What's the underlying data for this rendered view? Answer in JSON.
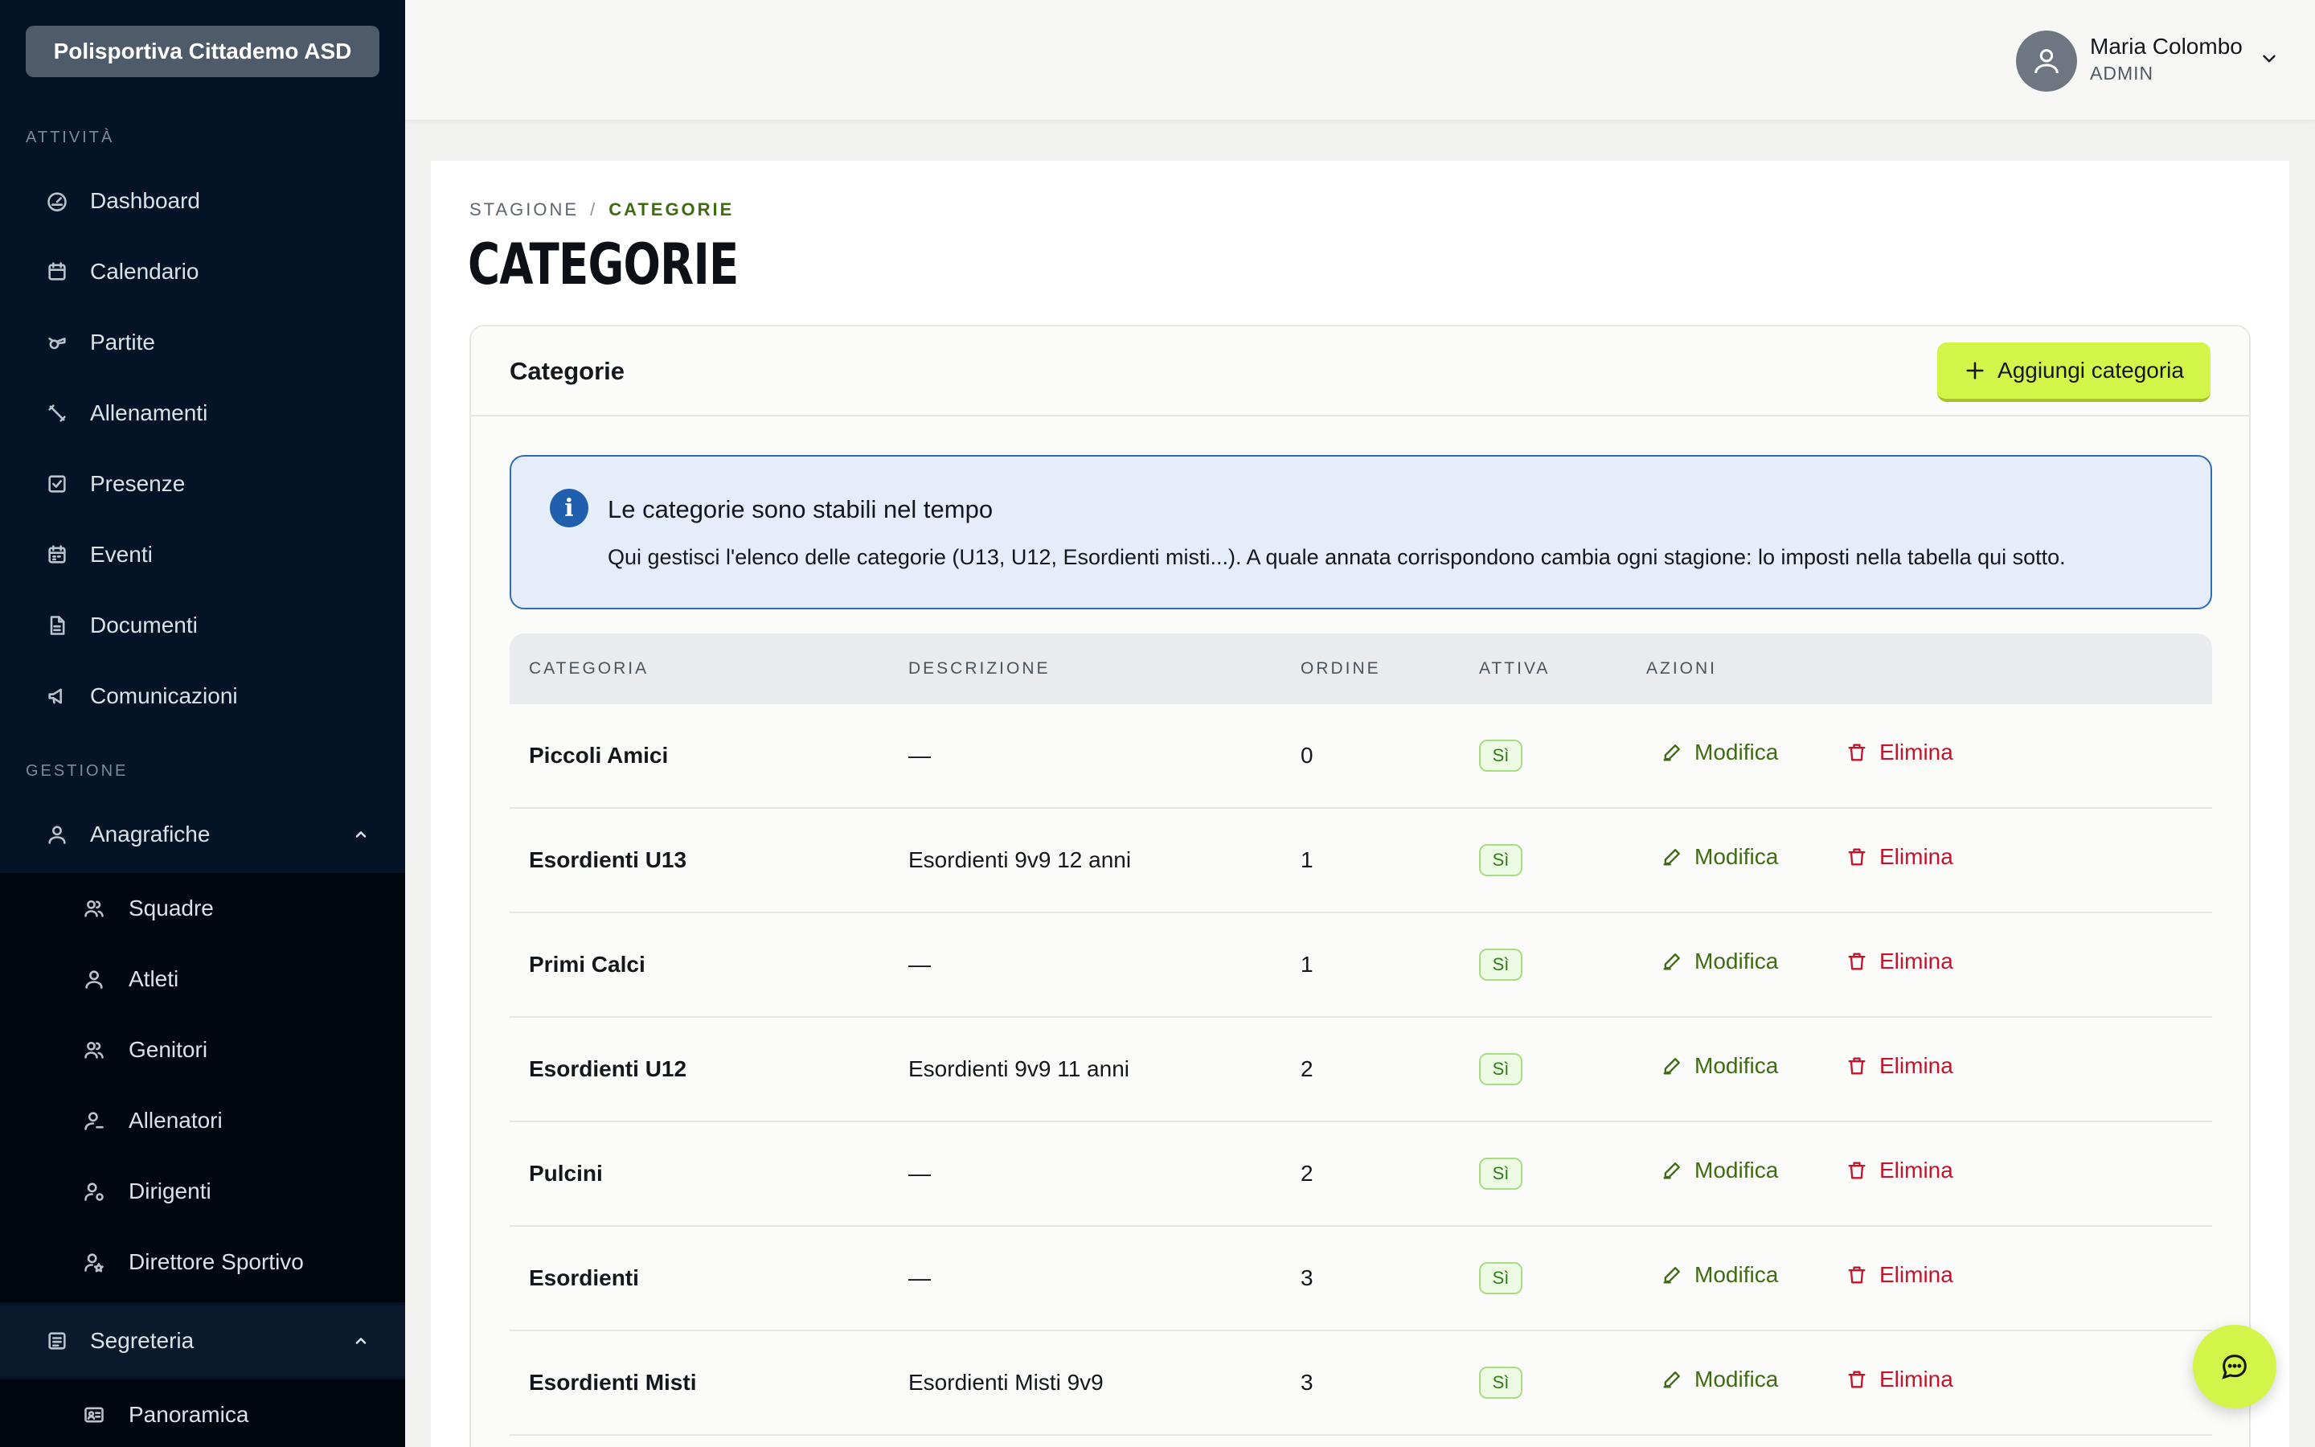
{
  "sidebar": {
    "org_name": "Polisportiva Cittademo ASD",
    "section_activities": "ATTIVITÀ",
    "activities": [
      {
        "label": "Dashboard",
        "icon": "gauge-icon"
      },
      {
        "label": "Calendario",
        "icon": "calendar-icon"
      },
      {
        "label": "Partite",
        "icon": "whistle-icon"
      },
      {
        "label": "Allenamenti",
        "icon": "training-icon"
      },
      {
        "label": "Presenze",
        "icon": "checkbox-icon"
      },
      {
        "label": "Eventi",
        "icon": "calendar-event-icon"
      },
      {
        "label": "Documenti",
        "icon": "document-icon"
      },
      {
        "label": "Comunicazioni",
        "icon": "megaphone-icon"
      }
    ],
    "section_management": "GESTIONE",
    "anagrafiche": {
      "label": "Anagrafiche",
      "icon": "user-icon",
      "expanded": true,
      "items": [
        {
          "label": "Squadre",
          "icon": "users-icon"
        },
        {
          "label": "Atleti",
          "icon": "user-icon"
        },
        {
          "label": "Genitori",
          "icon": "users-icon"
        },
        {
          "label": "Allenatori",
          "icon": "coach-icon"
        },
        {
          "label": "Dirigenti",
          "icon": "user-gear-icon"
        },
        {
          "label": "Direttore Sportivo",
          "icon": "user-star-icon"
        }
      ]
    },
    "segreteria": {
      "label": "Segreteria",
      "icon": "ledger-icon",
      "expanded": true,
      "items": [
        {
          "label": "Panoramica",
          "icon": "id-card-icon"
        }
      ]
    }
  },
  "user": {
    "name": "Maria Colombo",
    "role": "ADMIN"
  },
  "breadcrumb": {
    "parent": "STAGIONE",
    "separator": "/",
    "current": "CATEGORIE"
  },
  "page_title": "CATEGORIE",
  "card": {
    "title": "Categorie",
    "add_button": "Aggiungi categoria"
  },
  "alert": {
    "title": "Le categorie sono stabili nel tempo",
    "text": "Qui gestisci l'elenco delle categorie (U13, U12, Esordienti misti...). A quale annata corrispondono cambia ogni stagione: lo imposti nella tabella qui sotto."
  },
  "table": {
    "columns": [
      "CATEGORIA",
      "DESCRIZIONE",
      "ORDINE",
      "ATTIVA",
      "AZIONI"
    ],
    "edit_label": "Modifica",
    "delete_label": "Elimina",
    "rows": [
      {
        "name": "Piccoli Amici",
        "description": "—",
        "order": "0",
        "active": "Sì"
      },
      {
        "name": "Esordienti U13",
        "description": "Esordienti 9v9 12 anni",
        "order": "1",
        "active": "Sì"
      },
      {
        "name": "Primi Calci",
        "description": "—",
        "order": "1",
        "active": "Sì"
      },
      {
        "name": "Esordienti U12",
        "description": "Esordienti 9v9 11 anni",
        "order": "2",
        "active": "Sì"
      },
      {
        "name": "Pulcini",
        "description": "—",
        "order": "2",
        "active": "Sì"
      },
      {
        "name": "Esordienti",
        "description": "—",
        "order": "3",
        "active": "Sì"
      },
      {
        "name": "Esordienti Misti",
        "description": "Esordienti Misti 9v9",
        "order": "3",
        "active": "Sì"
      }
    ]
  },
  "colors": {
    "sidebar_bg": "#041426",
    "accent_lime": "#d3f54a",
    "edit_green": "#3f6b12",
    "delete_red": "#c2142b",
    "info_blue": "#2e6cb8"
  }
}
